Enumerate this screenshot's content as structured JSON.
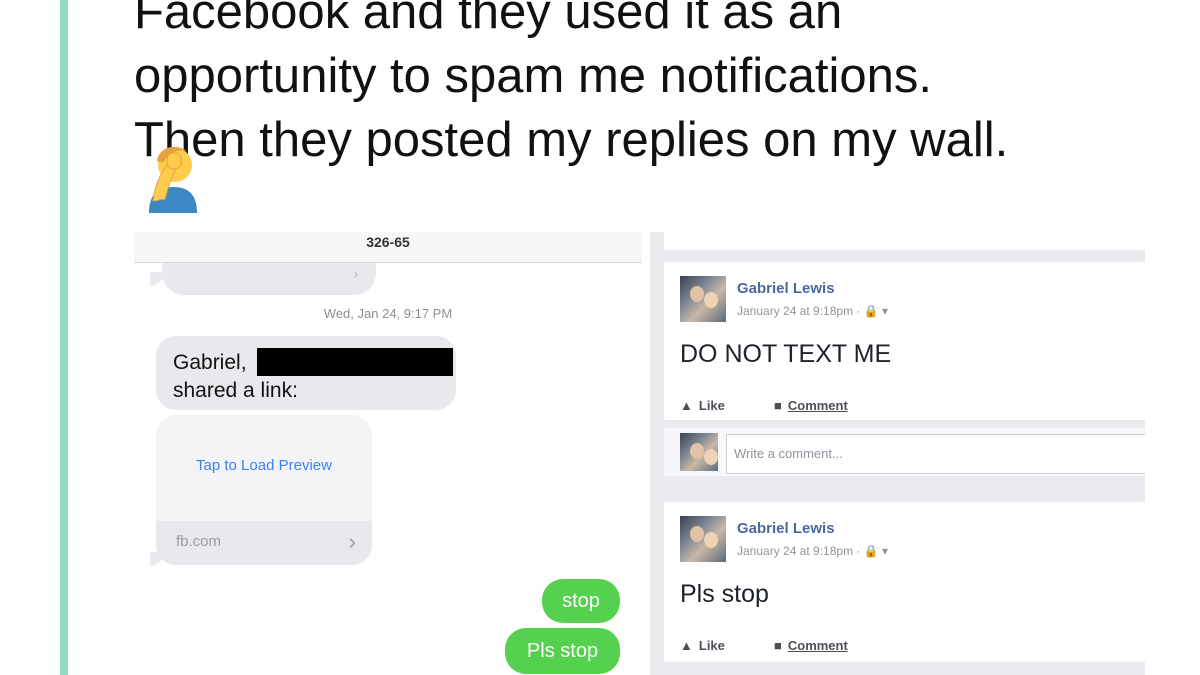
{
  "tweet": {
    "line1": "Facebook and they used it as an",
    "line2": "opportunity to spam me notifications.",
    "line3": "Then they posted my replies on my wall.",
    "emoji": "facepalm-emoji"
  },
  "imessage": {
    "header": "326-65",
    "timestamp": "Wed, Jan 24, 9:17 PM",
    "received": {
      "line1": "Gabriel,",
      "line2": "shared a link:"
    },
    "link_card": {
      "preview_label": "Tap to Load Preview",
      "domain": "fb.com"
    },
    "sent": [
      "stop",
      "Pls stop"
    ],
    "colors": {
      "sent_bubble": "#54d14e",
      "received_bubble": "#e8e8ed",
      "link": "#3b82f6"
    }
  },
  "facebook": {
    "posts": [
      {
        "author": "Gabriel Lewis",
        "meta": "January 24 at 9:18pm · 🔒 ▾",
        "text": "DO NOT TEXT ME",
        "like_label": "Like",
        "comment_label": "Comment"
      },
      {
        "author": "Gabriel Lewis",
        "meta": "January 24 at 9:18pm · 🔒 ▾",
        "text": "Pls stop",
        "like_label": "Like",
        "comment_label": "Comment"
      }
    ],
    "comment_placeholder": "Write a comment...",
    "colors": {
      "name": "#4b67a1",
      "background": "#e9ebee"
    }
  },
  "accent": {
    "quote_bar": "#8fdcbe"
  }
}
